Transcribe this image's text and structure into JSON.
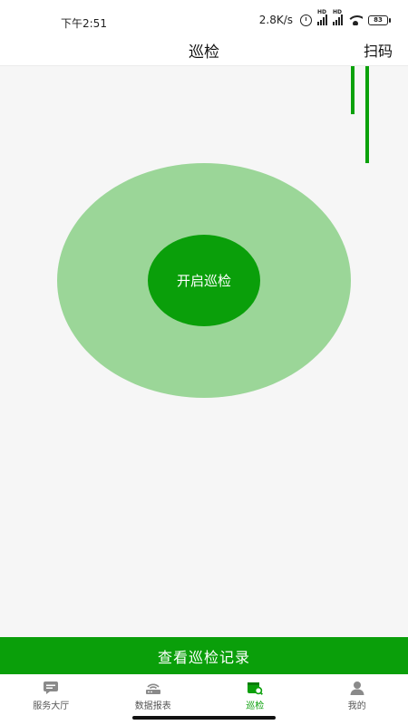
{
  "status": {
    "time": "下午2:51",
    "speed": "2.8K/s",
    "signal_tag": "HD",
    "battery": "83"
  },
  "header": {
    "title": "巡检",
    "scan_label": "扫码"
  },
  "patrol": {
    "start_label": "开启巡检"
  },
  "records": {
    "label": "查看巡检记录"
  },
  "tabs": [
    {
      "label": "服务大厅",
      "icon": "service-hall-icon",
      "active": false
    },
    {
      "label": "数据报表",
      "icon": "data-report-icon",
      "active": false
    },
    {
      "label": "巡检",
      "icon": "patrol-icon",
      "active": true
    },
    {
      "label": "我的",
      "icon": "profile-icon",
      "active": false
    }
  ],
  "colors": {
    "accent": "#0a9f0a",
    "ring": "#9bd698",
    "tab_inactive": "#8a8a8a"
  }
}
